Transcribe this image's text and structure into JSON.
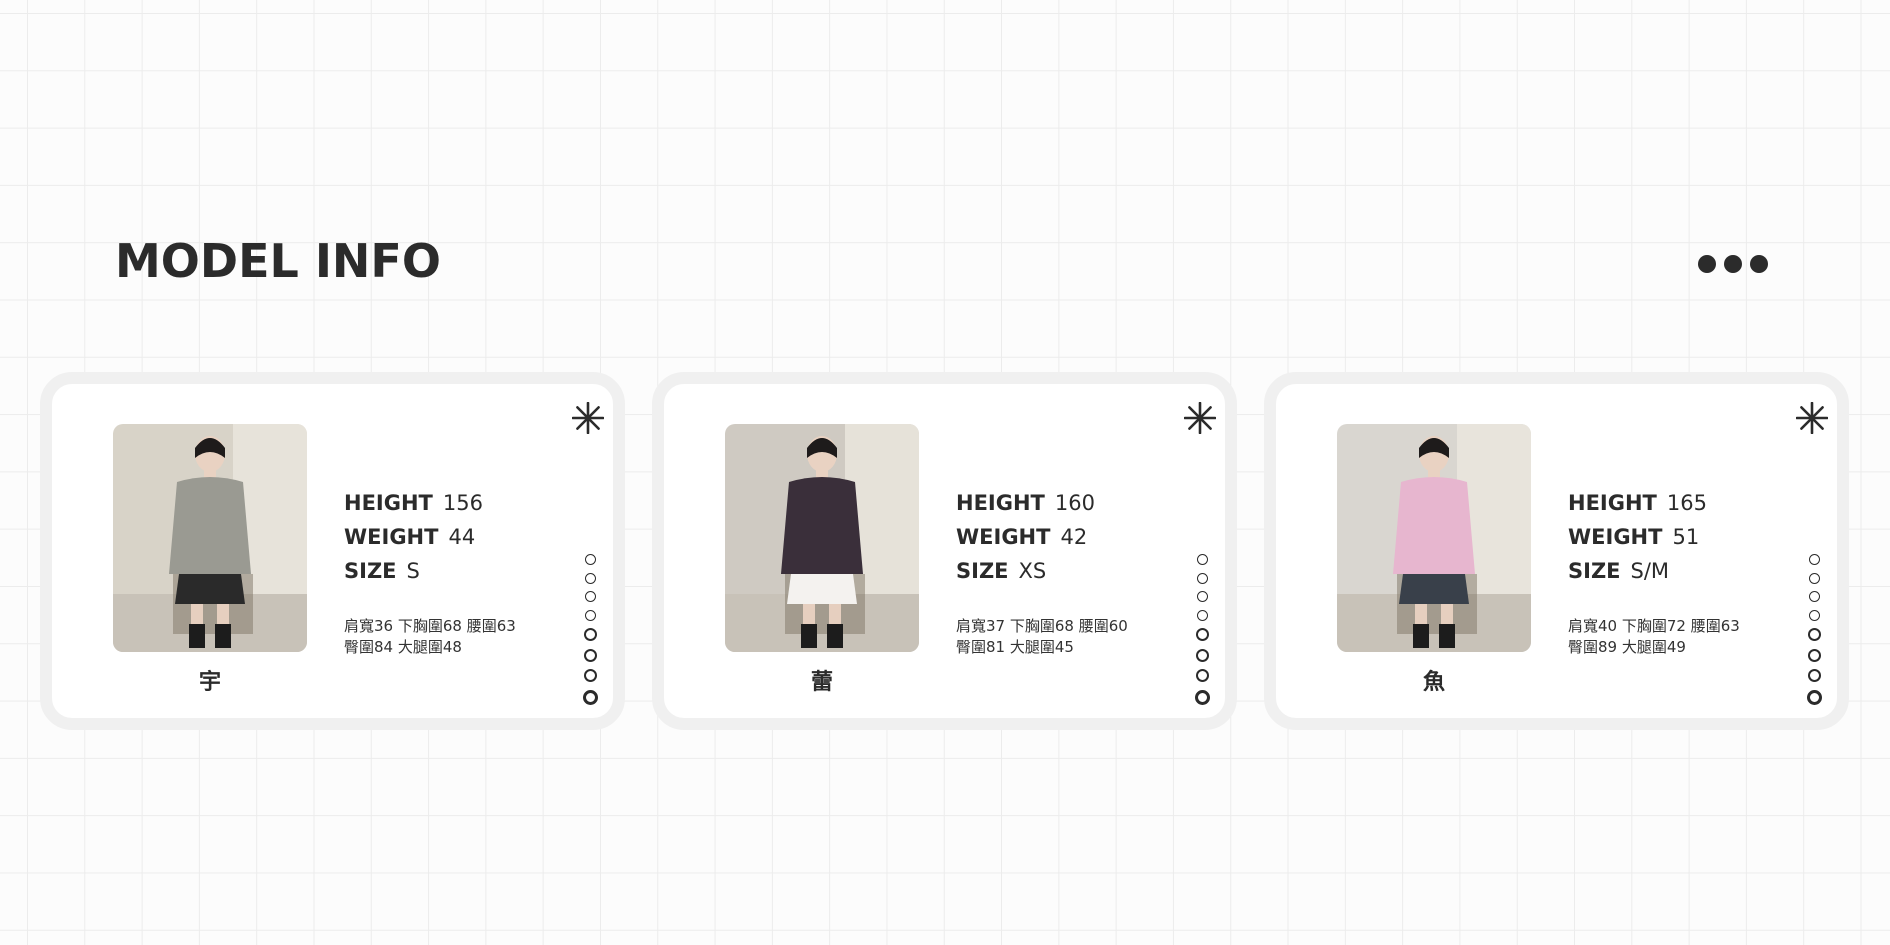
{
  "page": {
    "title": "MODEL INFO",
    "menu_icon": "more-dots-icon"
  },
  "labels": {
    "height": "HEIGHT",
    "weight": "WEIGHT",
    "size": "SIZE"
  },
  "models": [
    {
      "name": "宇",
      "height": "156",
      "weight": "44",
      "size": "S",
      "measure_line1": "肩寬36 下胸圍68 腰圍63",
      "measure_line2": "臀圍84 大腿圍48",
      "photo": "model-photo-grey-blazer",
      "colors": {
        "top": "#9a9a92",
        "bottom": "#2a2a2a",
        "bg": "#d8d3c8"
      }
    },
    {
      "name": "蕾",
      "height": "160",
      "weight": "42",
      "size": "XS",
      "measure_line1": "肩寬37 下胸圍68 腰圍60",
      "measure_line2": "臀圍81 大腿圍45",
      "photo": "model-photo-striped-sweater",
      "colors": {
        "top": "#3a2f3a",
        "bottom": "#f4f2ef",
        "bg": "#cfcac2"
      }
    },
    {
      "name": "魚",
      "height": "165",
      "weight": "51",
      "size": "S/M",
      "measure_line1": "肩寬40 下胸圍72 腰圍63",
      "measure_line2": "臀圍89 大腿圍49",
      "photo": "model-photo-pink-jacket",
      "colors": {
        "top": "#e7b6cf",
        "bottom": "#39404a",
        "bg": "#d9d6d0"
      }
    }
  ],
  "decor": {
    "star_icon": "asterisk-star-icon",
    "ring_icon": "ring-dot-icon"
  }
}
